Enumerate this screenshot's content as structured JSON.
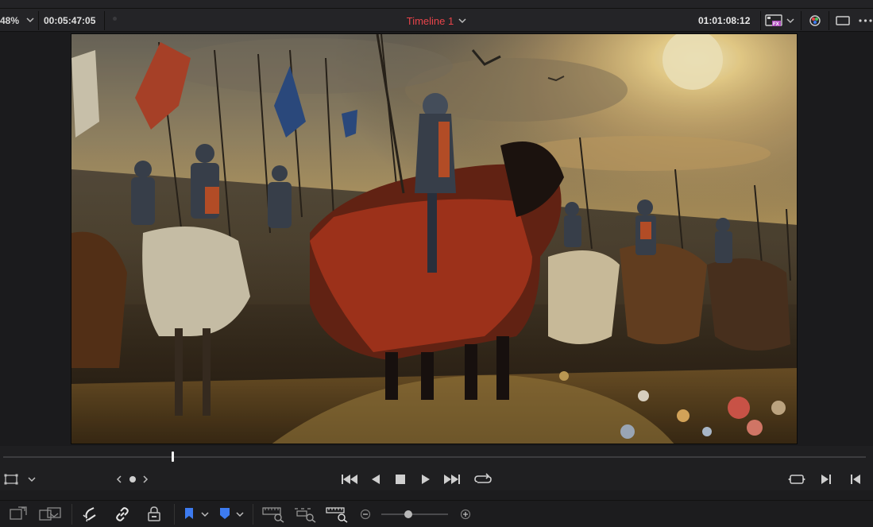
{
  "toolbar_top": {
    "zoom_label": "48%",
    "timecode_left": "00:05:47:05",
    "timeline_name": "Timeline 1",
    "timecode_right": "01:01:08:12",
    "fx_badge": "FX",
    "icons": [
      "chevron-down-icon",
      "video-fx-icon",
      "color-bypass-icon",
      "viewer-mode-icon",
      "more-icon"
    ]
  },
  "viewer": {
    "description_icons": [
      "frame-image"
    ]
  },
  "scrubber": {
    "playhead_position": 0.196
  },
  "transport": {
    "icons": [
      "viewer-mode-icon",
      "chevron-down-icon",
      "prev-clip-icon",
      "clip-dot-icon",
      "next-clip-icon",
      "jump-to-start-icon",
      "play-reverse-icon",
      "stop-icon",
      "play-icon",
      "jump-to-end-icon",
      "loop-icon",
      "match-frame-icon",
      "next-edit-icon",
      "prev-edit-icon"
    ]
  },
  "bottom_toolbar": {
    "icons": [
      "timeline-view-icon",
      "multicam-icon",
      "snapping-icon",
      "link-icon",
      "lock-icon",
      "flag-icon",
      "marker-icon",
      "zoom-full-icon",
      "zoom-detail-icon",
      "zoom-custom-icon",
      "zoom-out-icon",
      "zoom-in-icon"
    ],
    "zoom_level": 0.4,
    "colors": {
      "flag": "#3d7bf0",
      "marker": "#3d7bf0"
    }
  },
  "colors": {
    "accent_red": "#e8444a",
    "background": "#1c1c1e"
  }
}
